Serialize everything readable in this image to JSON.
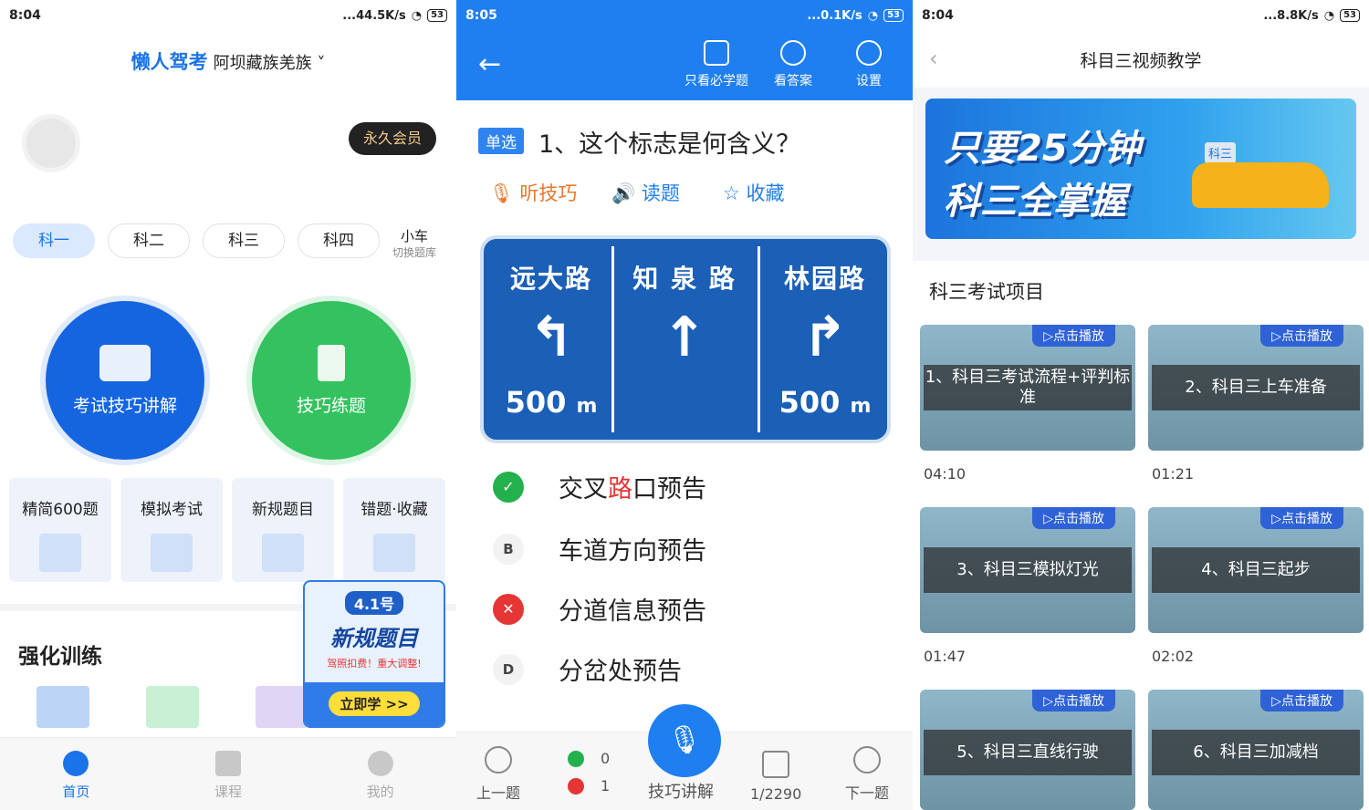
{
  "screens": [
    {
      "status": {
        "time": "8:04",
        "speed": "...44.5K/s",
        "battery": "53"
      }
    },
    {
      "status": {
        "time": "8:05",
        "speed": "...0.1K/s",
        "battery": "53"
      }
    },
    {
      "status": {
        "time": "8:04",
        "speed": "...8.8K/s",
        "battery": "53"
      }
    }
  ],
  "home": {
    "brand": "懒人驾考",
    "region": "阿坝藏族羌族",
    "vip": "永久会员",
    "subjects": [
      "科一",
      "科二",
      "科三",
      "科四"
    ],
    "switch": {
      "label": "小车",
      "sub": "切换题库"
    },
    "circle_explain": "考试技巧讲解",
    "circle_practice": "技巧练题",
    "cards": [
      "精简600题",
      "模拟考试",
      "新规题目",
      "错题·收藏"
    ],
    "section": "强化训练",
    "promo": {
      "tag": "4.1号",
      "title": "新规题目",
      "sub": "驾照扣费！重大调整!",
      "button": "立即学 >>"
    },
    "tabs": [
      "首页",
      "课程",
      "我的"
    ]
  },
  "quiz": {
    "header": [
      "只看必学题",
      "看答案",
      "设置"
    ],
    "type": "单选",
    "question": "1、这个标志是何含义？",
    "actions": [
      "听技巧",
      "读题",
      "收藏"
    ],
    "sign": {
      "left": "远大路",
      "mid": "知 泉 路",
      "right": "林园路",
      "dist": "500",
      "unit": "m"
    },
    "options": [
      {
        "letter": "",
        "pre": "交叉",
        "hl": "路",
        "post": "口预告"
      },
      {
        "letter": "B",
        "text": "车道方向预告"
      },
      {
        "letter": "",
        "text": "分道信息预告"
      },
      {
        "letter": "D",
        "text": "分岔处预告"
      }
    ],
    "footer": {
      "prev": "上一题",
      "correct": "0",
      "wrong": "1",
      "explain": "技巧讲解",
      "progress": "1/2290",
      "next": "下一题"
    }
  },
  "video": {
    "title": "科目三视频教学",
    "banner": {
      "line1": "只要25分钟",
      "line2": "科三全掌握",
      "tag": "科三"
    },
    "section": "科三考试项目",
    "play_label": "点击播放",
    "items": [
      {
        "title": "1、科目三考试流程+评判标准",
        "duration": "04:10"
      },
      {
        "title": "2、科目三上车准备",
        "duration": "01:21"
      },
      {
        "title": "3、科目三模拟灯光",
        "duration": "01:47"
      },
      {
        "title": "4、科目三起步",
        "duration": "02:02"
      },
      {
        "title": "5、科目三直线行驶",
        "duration": ""
      },
      {
        "title": "6、科目三加减档",
        "duration": ""
      }
    ]
  }
}
